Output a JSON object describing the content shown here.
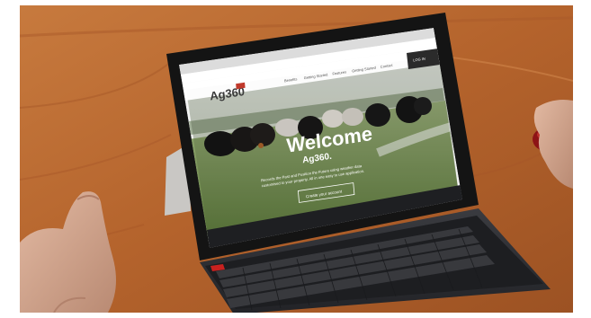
{
  "site": {
    "logo_text": "Ag360",
    "nav": [
      "Benefits",
      "Getting Started",
      "Features",
      "Getting Started",
      "Contact"
    ],
    "login_label": "LOG IN",
    "hero_title": "Welcome",
    "hero_subtitle": "Ag360.",
    "hero_line1": "Records the Past and Position the Future using weather data",
    "hero_line2": "customised to your property. All in one easy to use application.",
    "cta_label": "Create your account"
  },
  "colors": {
    "table": "#b86a33",
    "tablet_bezel": "#141414",
    "keyboard": "#2a2b2f",
    "accent_red": "#c8211f",
    "logo_red": "#c0392b"
  }
}
